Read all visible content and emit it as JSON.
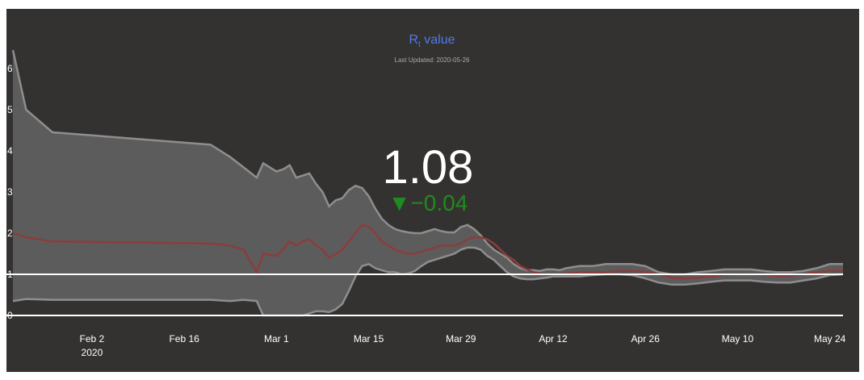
{
  "title": {
    "main": "R",
    "subscript": "t",
    "suffix": " value"
  },
  "last_updated": "Last Updated: 2020-05-26",
  "current": {
    "value": "1.08",
    "change": "−0.04",
    "direction": "down",
    "direction_symbol": "▼"
  },
  "colors": {
    "background": "#343231",
    "title": "#4f7be8",
    "band_fill": "#5c5c5c",
    "band_edge": "#8e8e8e",
    "mean_line": "#8c3c3c",
    "reference_line": "#ffffff",
    "change_down": "#1f8b1f",
    "text": "#ffffff"
  },
  "chart_data": {
    "type": "area",
    "title": "Rt value",
    "xlabel": "",
    "ylabel": "",
    "ylim": [
      0,
      6.6
    ],
    "xlim": [
      "2020-01-21",
      "2020-05-26"
    ],
    "grid": false,
    "legend": "none",
    "y_ticks": [
      0,
      1,
      2,
      3,
      4,
      5,
      6
    ],
    "x_ticks": [
      {
        "date": "2020-02-02",
        "label": "Feb 2",
        "sublabel": "2020"
      },
      {
        "date": "2020-02-16",
        "label": "Feb 16",
        "sublabel": ""
      },
      {
        "date": "2020-03-01",
        "label": "Mar 1",
        "sublabel": ""
      },
      {
        "date": "2020-03-15",
        "label": "Mar 15",
        "sublabel": ""
      },
      {
        "date": "2020-03-29",
        "label": "Mar 29",
        "sublabel": ""
      },
      {
        "date": "2020-04-12",
        "label": "Apr 12",
        "sublabel": ""
      },
      {
        "date": "2020-04-26",
        "label": "Apr 26",
        "sublabel": ""
      },
      {
        "date": "2020-05-10",
        "label": "May 10",
        "sublabel": ""
      },
      {
        "date": "2020-05-24",
        "label": "May 24",
        "sublabel": ""
      }
    ],
    "reference_lines": [
      1,
      0
    ],
    "series": [
      {
        "x": [
          "2020-01-21",
          "2020-01-23",
          "2020-01-27",
          "2020-02-20",
          "2020-02-23",
          "2020-02-25",
          "2020-02-27",
          "2020-02-28",
          "2020-03-01",
          "2020-03-02",
          "2020-03-03",
          "2020-03-04",
          "2020-03-05",
          "2020-03-06",
          "2020-03-07",
          "2020-03-08",
          "2020-03-09",
          "2020-03-10",
          "2020-03-11",
          "2020-03-12",
          "2020-03-13",
          "2020-03-14",
          "2020-03-15",
          "2020-03-16",
          "2020-03-17",
          "2020-03-18",
          "2020-03-19",
          "2020-03-20",
          "2020-03-21",
          "2020-03-22",
          "2020-03-23",
          "2020-03-24",
          "2020-03-25",
          "2020-03-26",
          "2020-03-27",
          "2020-03-28",
          "2020-03-29",
          "2020-03-30",
          "2020-03-31",
          "2020-04-01",
          "2020-04-02",
          "2020-04-03",
          "2020-04-04",
          "2020-04-05",
          "2020-04-06",
          "2020-04-07",
          "2020-04-08",
          "2020-04-09",
          "2020-04-10",
          "2020-04-11",
          "2020-04-12",
          "2020-04-13",
          "2020-04-14",
          "2020-04-16",
          "2020-04-18",
          "2020-04-20",
          "2020-04-22",
          "2020-04-24",
          "2020-04-26",
          "2020-04-28",
          "2020-04-30",
          "2020-05-02",
          "2020-05-04",
          "2020-05-06",
          "2020-05-08",
          "2020-05-10",
          "2020-05-12",
          "2020-05-14",
          "2020-05-16",
          "2020-05-18",
          "2020-05-20",
          "2020-05-22",
          "2020-05-24",
          "2020-05-26"
        ],
        "mean": [
          2.0,
          1.9,
          1.8,
          1.75,
          1.7,
          1.6,
          1.05,
          1.5,
          1.45,
          1.6,
          1.8,
          1.7,
          1.8,
          1.85,
          1.7,
          1.6,
          1.4,
          1.5,
          1.6,
          1.8,
          2.0,
          2.2,
          2.15,
          2.0,
          1.8,
          1.7,
          1.6,
          1.55,
          1.5,
          1.5,
          1.55,
          1.6,
          1.65,
          1.7,
          1.7,
          1.7,
          1.75,
          1.85,
          1.9,
          1.9,
          1.85,
          1.75,
          1.6,
          1.45,
          1.35,
          1.2,
          1.12,
          1.05,
          1.02,
          1.0,
          1.0,
          1.0,
          1.02,
          1.05,
          1.05,
          1.05,
          1.08,
          1.08,
          1.06,
          1.0,
          0.92,
          0.9,
          0.92,
          0.95,
          0.98,
          1.0,
          1.0,
          0.98,
          0.96,
          0.96,
          1.0,
          1.05,
          1.08,
          1.08
        ],
        "upper": [
          6.45,
          5.0,
          4.45,
          4.15,
          3.85,
          3.6,
          3.35,
          3.7,
          3.5,
          3.55,
          3.65,
          3.35,
          3.4,
          3.45,
          3.2,
          3.0,
          2.65,
          2.8,
          2.85,
          3.05,
          3.15,
          3.1,
          2.9,
          2.6,
          2.35,
          2.2,
          2.1,
          2.05,
          2.02,
          2.0,
          2.0,
          2.05,
          2.1,
          2.05,
          2.02,
          2.02,
          2.15,
          2.2,
          2.1,
          1.95,
          1.75,
          1.6,
          1.5,
          1.4,
          1.25,
          1.15,
          1.1,
          1.1,
          1.08,
          1.12,
          1.12,
          1.1,
          1.15,
          1.2,
          1.2,
          1.25,
          1.25,
          1.25,
          1.2,
          1.05,
          1.0,
          1.0,
          1.05,
          1.08,
          1.12,
          1.12,
          1.12,
          1.08,
          1.05,
          1.05,
          1.08,
          1.15,
          1.25,
          1.25
        ],
        "lower": [
          0.35,
          0.4,
          0.38,
          0.38,
          0.35,
          0.38,
          0.35,
          0.0,
          0.0,
          0.0,
          0.0,
          0.0,
          0.0,
          0.05,
          0.1,
          0.1,
          0.08,
          0.15,
          0.28,
          0.6,
          0.95,
          1.2,
          1.25,
          1.15,
          1.1,
          1.05,
          1.05,
          1.0,
          1.02,
          1.08,
          1.2,
          1.3,
          1.35,
          1.4,
          1.45,
          1.5,
          1.6,
          1.65,
          1.65,
          1.6,
          1.45,
          1.35,
          1.2,
          1.05,
          0.95,
          0.9,
          0.88,
          0.88,
          0.9,
          0.92,
          0.95,
          0.95,
          0.95,
          0.95,
          0.98,
          1.0,
          1.0,
          0.98,
          0.9,
          0.8,
          0.75,
          0.75,
          0.78,
          0.82,
          0.85,
          0.85,
          0.85,
          0.82,
          0.8,
          0.8,
          0.85,
          0.9,
          0.98,
          1.0
        ]
      }
    ]
  }
}
